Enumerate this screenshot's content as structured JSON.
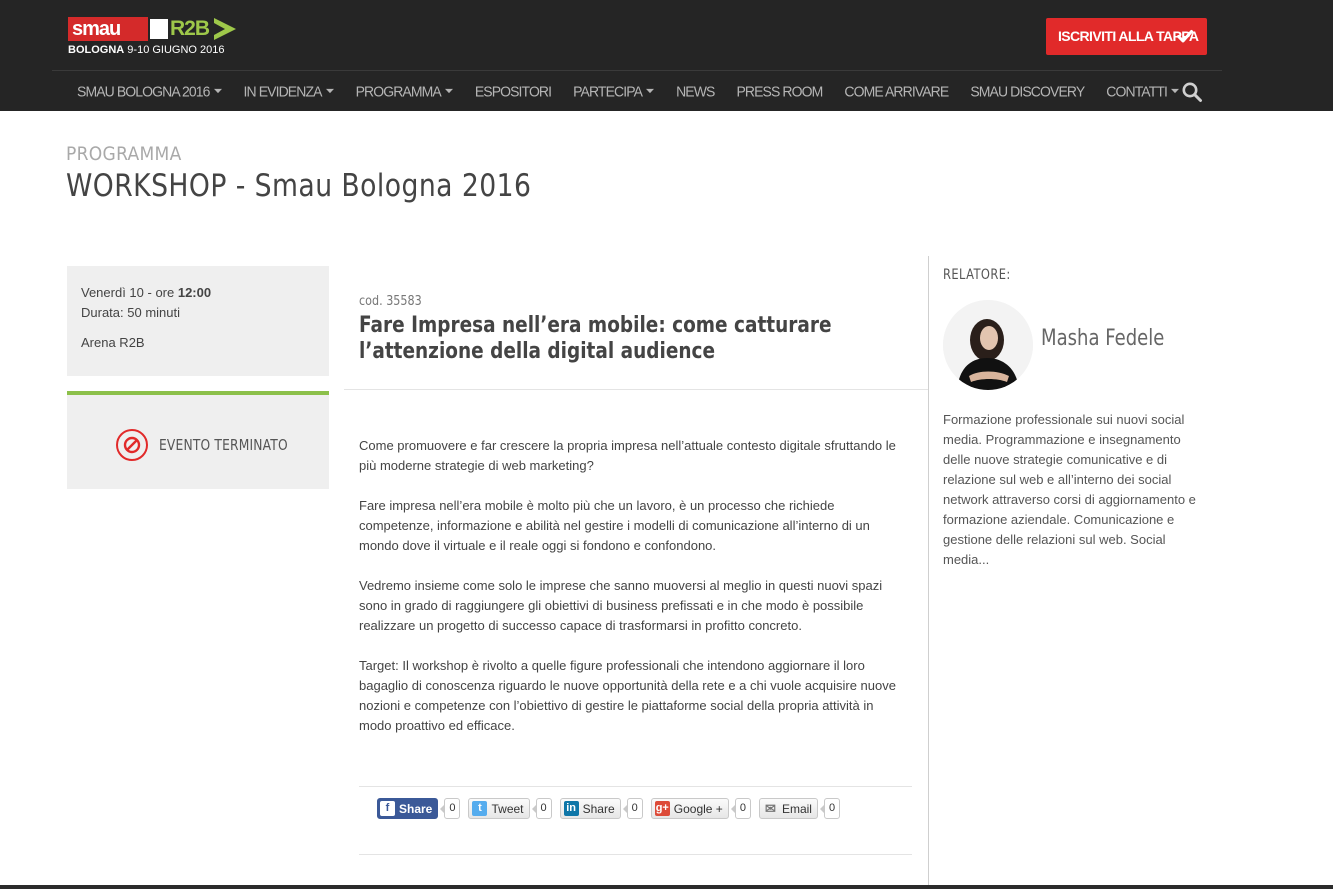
{
  "header": {
    "logo": {
      "brand": "smau",
      "partner": "R2B",
      "city": "BOLOGNA",
      "dates": "9-10 GIUGNO 2016"
    },
    "cta_label": "ISCRIVITI ALLA TAPPA",
    "nav": [
      {
        "label": "SMAU BOLOGNA 2016",
        "has_dropdown": true
      },
      {
        "label": "IN EVIDENZA",
        "has_dropdown": true
      },
      {
        "label": "PROGRAMMA",
        "has_dropdown": true
      },
      {
        "label": "ESPOSITORI",
        "has_dropdown": false
      },
      {
        "label": "PARTECIPA",
        "has_dropdown": true
      },
      {
        "label": "NEWS",
        "has_dropdown": false
      },
      {
        "label": "PRESS ROOM",
        "has_dropdown": false
      },
      {
        "label": "COME ARRIVARE",
        "has_dropdown": false
      },
      {
        "label": "SMAU DISCOVERY",
        "has_dropdown": false
      },
      {
        "label": "CONTATTI",
        "has_dropdown": true
      }
    ]
  },
  "page": {
    "kicker": "PROGRAMMA",
    "title": "WORKSHOP - Smau Bologna 2016"
  },
  "event": {
    "day": "Venerdì 10 - ore ",
    "time": "12:00",
    "duration": "Durata: 50 minuti",
    "venue": "Arena R2B",
    "status": "EVENTO TERMINATO",
    "code": "cod. 35583",
    "title": "Fare Impresa nell’era mobile: come catturare l’attenzione della digital audience",
    "paragraphs": [
      "Come promuovere e far crescere la propria impresa nell’attuale contesto digitale sfruttando le più moderne strategie di web marketing?",
      "Fare impresa nell’era mobile è molto più che un lavoro, è un processo che richiede competenze, informazione e abilità nel gestire i modelli di comunicazione all’interno di un mondo dove il virtuale e il reale oggi si fondono e confondono.",
      "Vedremo insieme come solo le imprese che sanno muoversi al meglio in questi nuovi spazi sono in grado di raggiungere gli obiettivi di business prefissati e in che modo è possibile realizzare un progetto di successo capace di trasformarsi in profitto concreto.",
      "Target: Il workshop è rivolto a quelle figure professionali che intendono aggiornare il loro bagaglio di conoscenza riguardo le nuove opportunità della rete e a chi vuole acquisire nuove nozioni e competenze con l’obiettivo di gestire le piattaforme social della propria attività in modo proattivo ed efficace."
    ]
  },
  "share": [
    {
      "label": "Share",
      "count": "0",
      "icon": "facebook-icon",
      "glyph": "f",
      "color": "#3b5998"
    },
    {
      "label": "Tweet",
      "count": "0",
      "icon": "twitter-icon",
      "glyph": "t",
      "color": "#55acee"
    },
    {
      "label": "Share",
      "count": "0",
      "icon": "linkedin-icon",
      "glyph": "in",
      "color": "#0e76a8"
    },
    {
      "label": "Google +",
      "count": "0",
      "icon": "google-plus-icon",
      "glyph": "g+",
      "color": "#dd4b39"
    },
    {
      "label": "Email",
      "count": "0",
      "icon": "email-icon",
      "glyph": "✉",
      "color": "#888888"
    }
  ],
  "speaker": {
    "heading": "RELATORE:",
    "name": "Masha Fedele",
    "bio": "Formazione professionale sui nuovi social media. Programmazione e insegnamento delle nuove strategie comunicative e di relazione sul web e all’interno dei social network attraverso corsi di aggiornamento e formazione aziendale. Comunicazione e gestione delle relazioni sul web. Social media..."
  },
  "colors": {
    "header_bg": "#252525",
    "accent_red": "#e12a2a",
    "accent_green": "#8cc04a",
    "panel_bg": "#efefef"
  }
}
